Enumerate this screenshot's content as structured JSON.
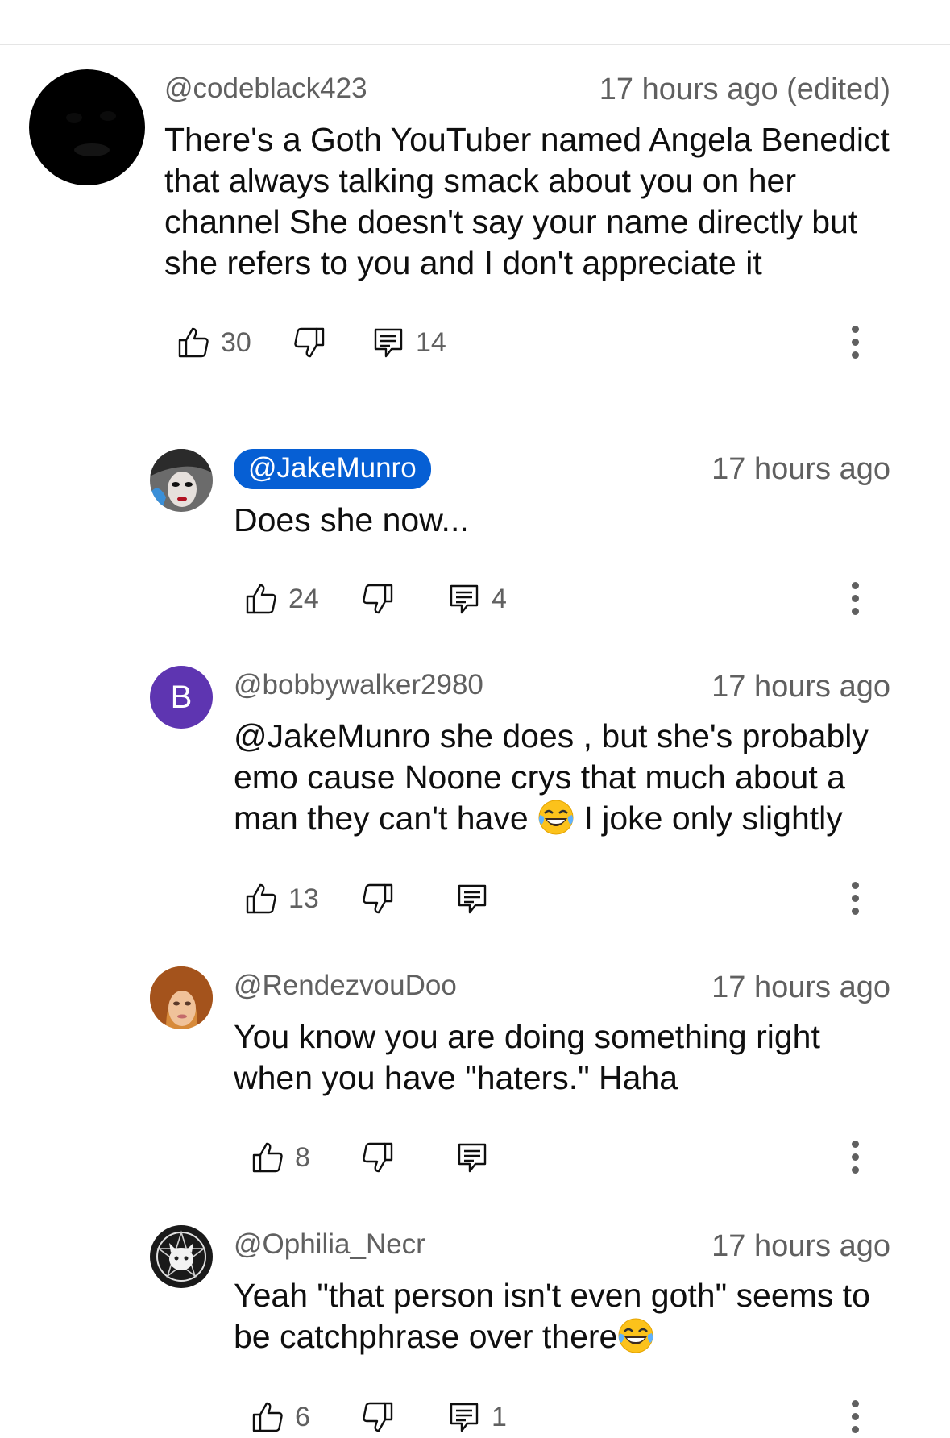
{
  "comments": [
    {
      "handle": "@codeblack423",
      "time": "17 hours ago (edited)",
      "text": "There's a Goth YouTuber named Angela Benedict\nthat always talking smack about you on her\nchannel She doesn't say your name directly but\nshe refers to you and I don't appreciate it",
      "likes": "30",
      "replies": "14"
    }
  ],
  "replies": [
    {
      "handle": "@JakeMunro",
      "time": "17 hours ago",
      "text": "Does she now...",
      "likes": "24",
      "replies": "4"
    },
    {
      "handle": "@bobbywalker2980",
      "avatar_letter": "B",
      "time": "17 hours ago",
      "text_part1": "@JakeMunro she does , but she's probably\nemo cause Noone crys that much about a\nman they can't have ",
      "text_part2": " I joke only slightly",
      "likes": "13"
    },
    {
      "handle": "@RendezvouDoo",
      "time": "17 hours ago",
      "text": "You know you are doing something right\nwhen you have \"haters.\" Haha",
      "likes": "8"
    },
    {
      "handle": "@Ophilia_Necr",
      "time": "17 hours ago",
      "text_part1": "Yeah \"that person isn't even goth\" seems to\nbe catchphrase over there",
      "likes": "6",
      "replies": "1"
    }
  ],
  "colors": {
    "accent": "#065fd4",
    "secondary_text": "#606060",
    "avatar_b": "#5e35b1"
  },
  "icons": [
    "thumbs-up-icon",
    "thumbs-down-icon",
    "reply-icon",
    "more-vert-icon",
    "face-with-tears-of-joy-emoji"
  ]
}
